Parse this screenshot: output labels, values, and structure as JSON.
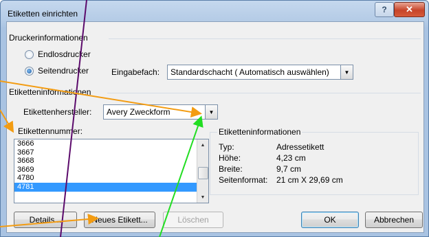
{
  "window": {
    "title": "Etiketten einrichten",
    "help_label": "?",
    "close_label": "✕"
  },
  "printer": {
    "heading": "Druckerinformationen",
    "continuous_label": "Endlosdrucker",
    "page_label": "Seitendrucker",
    "selected": "Seitendrucker",
    "tray_label": "Eingabefach:",
    "tray_value": "Standardschacht ( Automatisch auswählen)"
  },
  "labels": {
    "heading": "Etiketteninformationen",
    "vendor_label": "Etikettenhersteller:",
    "vendor_value": "Avery Zweckform",
    "number_label": "Etikettennummer:",
    "numbers": [
      "3666",
      "3667",
      "3668",
      "3669",
      "4780",
      "4781"
    ],
    "selected_number": "4781"
  },
  "info": {
    "heading": "Etiketteninformationen",
    "rows": [
      {
        "key": "Typ:",
        "value": "Adressetikett"
      },
      {
        "key": "Höhe:",
        "value": "4,23 cm"
      },
      {
        "key": "Breite:",
        "value": "9,7 cm"
      },
      {
        "key": "Seitenformat:",
        "value": "21 cm X 29,69 cm"
      }
    ]
  },
  "buttons": {
    "details": "Details...",
    "new_label": "Neues Etikett...",
    "delete": "Löschen",
    "ok": "OK",
    "cancel": "Abbrechen"
  },
  "annotation_colors": {
    "orange": "#f39c12",
    "green": "#22dd22",
    "purple": "#5b0a6b"
  }
}
